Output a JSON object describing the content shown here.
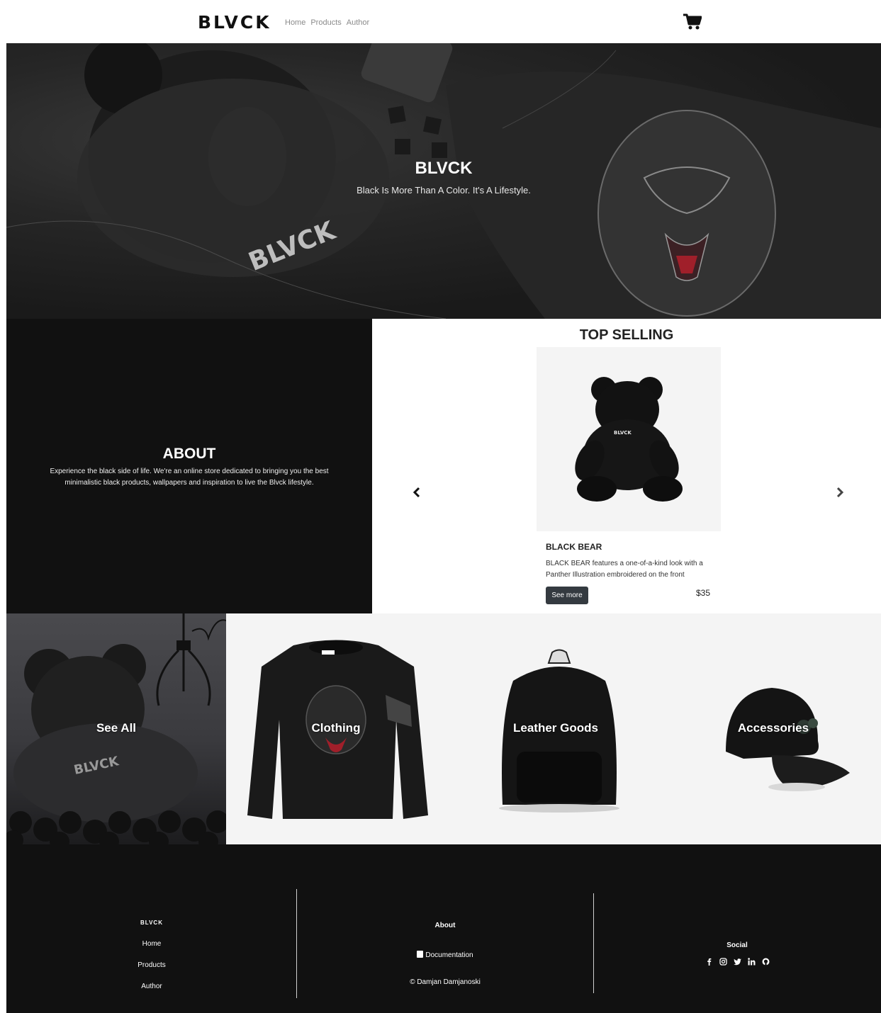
{
  "navbar": {
    "brand": "BLVCK",
    "links": [
      "Home",
      "Products",
      "Author"
    ],
    "cart_icon": "shopping-cart-icon"
  },
  "hero": {
    "title": "BLVCK",
    "subtitle": "Black Is More Than A Color. It's A Lifestyle."
  },
  "about": {
    "title": "ABOUT",
    "text": "Experience the black side of life. We're an online store dedicated to bringing you the best minimalistic black products, wallpapers and inspiration to live the Blvck lifestyle."
  },
  "top_selling": {
    "title": "TOP SELLING",
    "product": {
      "name": "BLACK BEAR",
      "description": "BLACK BEAR features a one-of-a-kind look with a Panther Illustration embroidered on the front",
      "button": "See more",
      "price": "$35"
    },
    "prev_icon": "chevron-left-icon",
    "next_icon": "chevron-right-icon"
  },
  "categories": [
    {
      "label": "See All"
    },
    {
      "label": "Clothing"
    },
    {
      "label": "Leather Goods"
    },
    {
      "label": "Accessories"
    }
  ],
  "footer": {
    "col1": {
      "brand": "BLVCK",
      "links": [
        "Home",
        "Products",
        "Author"
      ]
    },
    "col2": {
      "about": "About",
      "documentation": "Documentation",
      "copyright": "© Damjan Damjanoski"
    },
    "col3": {
      "title": "Social",
      "icons": [
        "facebook-icon",
        "instagram-icon",
        "twitter-icon",
        "linkedin-icon",
        "github-icon"
      ]
    }
  },
  "colors": {
    "dark": "#111111",
    "button": "#343a40",
    "product_bg": "#f4f4f4",
    "nav_link": "#8a8a8a"
  }
}
